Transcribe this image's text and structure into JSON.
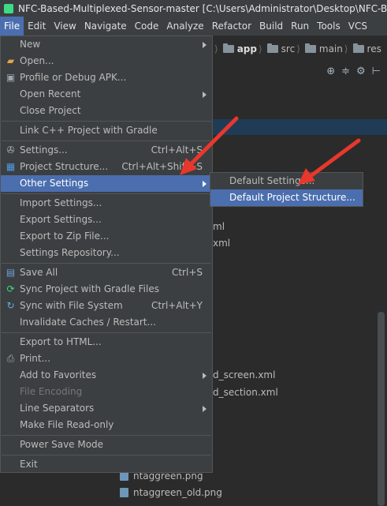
{
  "window": {
    "title": "NFC-Based-Multiplexed-Sensor-master [C:\\Users\\Administrator\\Desktop\\NFC-Ba"
  },
  "menubar": [
    "File",
    "Edit",
    "View",
    "Navigate",
    "Code",
    "Analyze",
    "Refactor",
    "Build",
    "Run",
    "Tools",
    "VCS"
  ],
  "breadcrumb": {
    "app": "app",
    "src": "src",
    "main": "main",
    "res": "res"
  },
  "file_menu": {
    "new": "New",
    "open": "Open...",
    "profile": "Profile or Debug APK...",
    "open_recent": "Open Recent",
    "close_project": "Close Project",
    "link_cpp": "Link C++ Project with Gradle",
    "settings": "Settings...",
    "settings_sc": "Ctrl+Alt+S",
    "project_structure": "Project Structure...",
    "project_structure_sc": "Ctrl+Alt+Shift+S",
    "other_settings": "Other Settings",
    "import_settings": "Import Settings...",
    "export_settings": "Export Settings...",
    "export_zip": "Export to Zip File...",
    "settings_repo": "Settings Repository...",
    "save_all": "Save All",
    "save_all_sc": "Ctrl+S",
    "sync_gradle": "Sync Project with Gradle Files",
    "sync_fs": "Sync with File System",
    "sync_fs_sc": "Ctrl+Alt+Y",
    "invalidate": "Invalidate Caches / Restart...",
    "export_html": "Export to HTML...",
    "print": "Print...",
    "add_favorites": "Add to Favorites",
    "file_encoding": "File Encoding",
    "line_separators": "Line Separators",
    "make_readonly": "Make File Read-only",
    "power_save": "Power Save Mode",
    "exit": "Exit"
  },
  "other_settings_submenu": {
    "default_settings": "Default Settings...",
    "default_project_structure": "Default Project Structure..."
  },
  "background_tree": {
    "frag1": "ml",
    "frag2": "xml",
    "frag3": "d_screen.xml",
    "frag4": "d_section.xml",
    "file1": "ntaggreen.png",
    "file2": "ntaggreen_old.png"
  },
  "colors": {
    "accent": "#4b6eaf",
    "menu_bg": "#3c3f41",
    "annotation": "#e8372c"
  }
}
